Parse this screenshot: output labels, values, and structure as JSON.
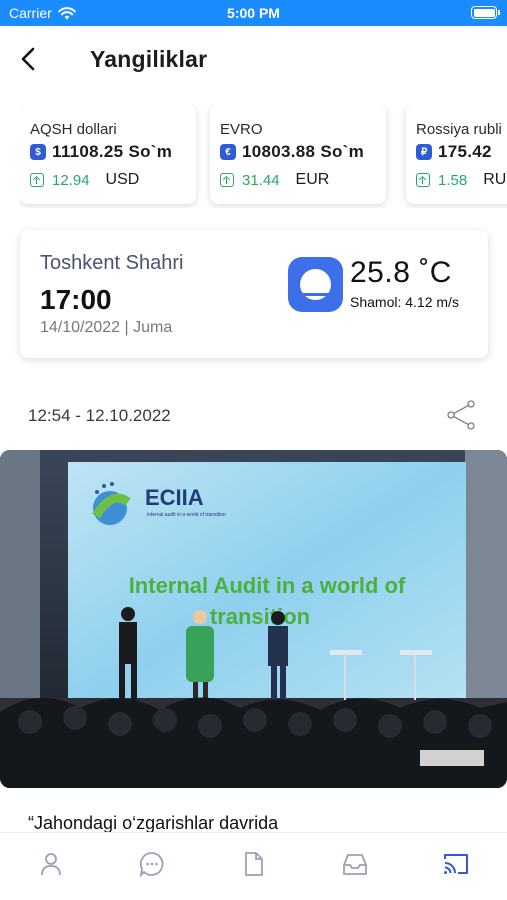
{
  "status_bar": {
    "carrier": "Carrier",
    "time": "5:00 PM"
  },
  "header": {
    "title": "Yangiliklar"
  },
  "rates": [
    {
      "name": "AQSH dollari",
      "symbol": "$",
      "value": "11108.25 So`m",
      "change": "12.94",
      "code": "USD"
    },
    {
      "name": "EVRO",
      "symbol": "€",
      "value": "10803.88 So`m",
      "change": "31.44",
      "code": "EUR"
    },
    {
      "name": "Rossiya rubli",
      "symbol": "₽",
      "value": "175.42",
      "change": "1.58",
      "code": "RUB"
    }
  ],
  "weather": {
    "city": "Toshkent Shahri",
    "time": "17:00",
    "date": "14/10/2022 | Juma",
    "temperature": "25.8 ˚C",
    "wind": "Shamol: 4.12 m/s"
  },
  "article": {
    "timestamp": "12:54 - 12.10.2022",
    "photo": {
      "logo_text": "ECIIA",
      "logo_sub": "internal audit in a world of transition",
      "slide_text_line1": "Internal Audit in a world of",
      "slide_text_line2": "transition"
    },
    "title": "“Jahondagi o‘zgarishlar davrida"
  },
  "colors": {
    "status_bar": "#1a8cff",
    "accent": "#2f5bd9",
    "positive": "#27a96a",
    "tab_active": "#2f5bd9",
    "tab_inactive": "#9aa0b4"
  },
  "tabbar": {
    "items": [
      "profile-icon",
      "chat-icon",
      "document-icon",
      "inbox-icon",
      "cast-icon"
    ],
    "active_index": 4
  }
}
